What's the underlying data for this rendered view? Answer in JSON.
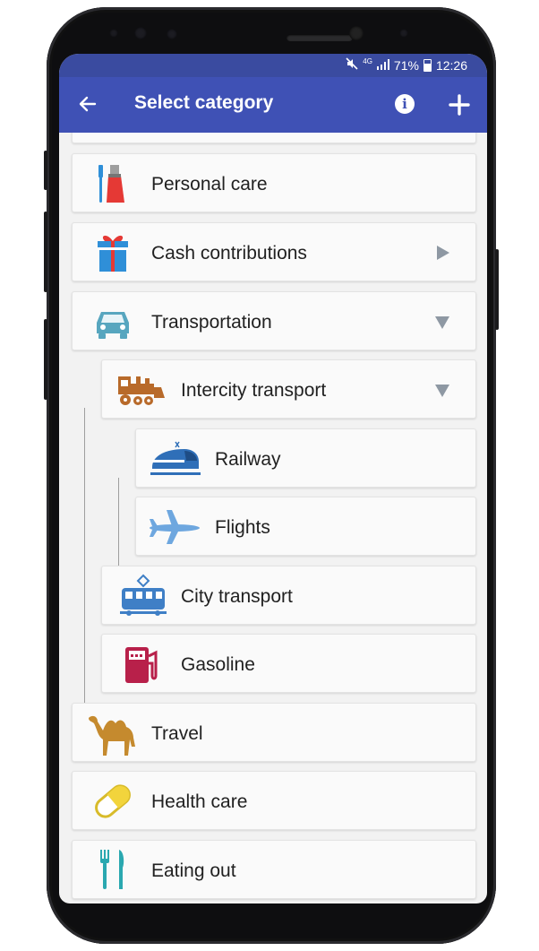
{
  "status_bar": {
    "network": "4G",
    "battery": "71%",
    "time": "12:26"
  },
  "app_bar": {
    "title": "Select category"
  },
  "categories": [
    {
      "label": "Personal care",
      "icon": "toothbrush-icon",
      "expand": "none"
    },
    {
      "label": "Cash contributions",
      "icon": "gift-icon",
      "expand": "collapsed"
    },
    {
      "label": "Transportation",
      "icon": "car-icon",
      "expand": "expanded"
    },
    {
      "label": "Intercity transport",
      "icon": "locomotive-icon",
      "expand": "expanded"
    },
    {
      "label": "Railway",
      "icon": "train-icon",
      "expand": "none"
    },
    {
      "label": "Flights",
      "icon": "airplane-icon",
      "expand": "none"
    },
    {
      "label": "City transport",
      "icon": "tram-icon",
      "expand": "none"
    },
    {
      "label": "Gasoline",
      "icon": "fuel-pump-icon",
      "expand": "none"
    },
    {
      "label": "Travel",
      "icon": "camel-icon",
      "expand": "none"
    },
    {
      "label": "Health care",
      "icon": "pill-icon",
      "expand": "none"
    },
    {
      "label": "Eating out",
      "icon": "cutlery-icon",
      "expand": "none"
    }
  ],
  "colors": {
    "status_bar": "#3a4ba0",
    "app_bar": "#3f51b5",
    "arrow": "#8e98a3",
    "card": "#fafafa"
  }
}
